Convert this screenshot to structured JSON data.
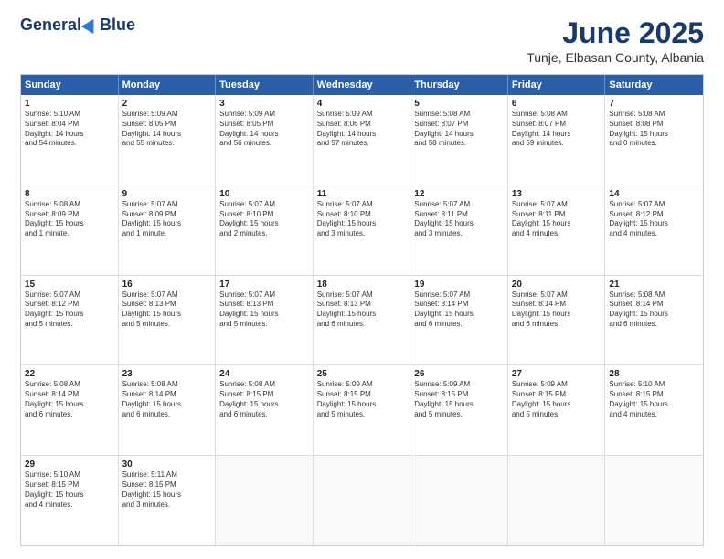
{
  "header": {
    "logo_general": "General",
    "logo_blue": "Blue",
    "month_title": "June 2025",
    "subtitle": "Tunje, Elbasan County, Albania"
  },
  "calendar": {
    "days_of_week": [
      "Sunday",
      "Monday",
      "Tuesday",
      "Wednesday",
      "Thursday",
      "Friday",
      "Saturday"
    ],
    "weeks": [
      [
        {
          "day": "",
          "text": ""
        },
        {
          "day": "2",
          "text": "Sunrise: 5:09 AM\nSunset: 8:05 PM\nDaylight: 14 hours\nand 55 minutes."
        },
        {
          "day": "3",
          "text": "Sunrise: 5:09 AM\nSunset: 8:05 PM\nDaylight: 14 hours\nand 56 minutes."
        },
        {
          "day": "4",
          "text": "Sunrise: 5:09 AM\nSunset: 8:06 PM\nDaylight: 14 hours\nand 57 minutes."
        },
        {
          "day": "5",
          "text": "Sunrise: 5:08 AM\nSunset: 8:07 PM\nDaylight: 14 hours\nand 58 minutes."
        },
        {
          "day": "6",
          "text": "Sunrise: 5:08 AM\nSunset: 8:07 PM\nDaylight: 14 hours\nand 59 minutes."
        },
        {
          "day": "7",
          "text": "Sunrise: 5:08 AM\nSunset: 8:08 PM\nDaylight: 15 hours\nand 0 minutes."
        }
      ],
      [
        {
          "day": "1",
          "text": "Sunrise: 5:10 AM\nSunset: 8:04 PM\nDaylight: 14 hours\nand 54 minutes."
        },
        {
          "day": "9",
          "text": "Sunrise: 5:07 AM\nSunset: 8:09 PM\nDaylight: 15 hours\nand 1 minute."
        },
        {
          "day": "10",
          "text": "Sunrise: 5:07 AM\nSunset: 8:10 PM\nDaylight: 15 hours\nand 2 minutes."
        },
        {
          "day": "11",
          "text": "Sunrise: 5:07 AM\nSunset: 8:10 PM\nDaylight: 15 hours\nand 3 minutes."
        },
        {
          "day": "12",
          "text": "Sunrise: 5:07 AM\nSunset: 8:11 PM\nDaylight: 15 hours\nand 3 minutes."
        },
        {
          "day": "13",
          "text": "Sunrise: 5:07 AM\nSunset: 8:11 PM\nDaylight: 15 hours\nand 4 minutes."
        },
        {
          "day": "14",
          "text": "Sunrise: 5:07 AM\nSunset: 8:12 PM\nDaylight: 15 hours\nand 4 minutes."
        }
      ],
      [
        {
          "day": "8",
          "text": "Sunrise: 5:08 AM\nSunset: 8:09 PM\nDaylight: 15 hours\nand 1 minute."
        },
        {
          "day": "16",
          "text": "Sunrise: 5:07 AM\nSunset: 8:13 PM\nDaylight: 15 hours\nand 5 minutes."
        },
        {
          "day": "17",
          "text": "Sunrise: 5:07 AM\nSunset: 8:13 PM\nDaylight: 15 hours\nand 5 minutes."
        },
        {
          "day": "18",
          "text": "Sunrise: 5:07 AM\nSunset: 8:13 PM\nDaylight: 15 hours\nand 6 minutes."
        },
        {
          "day": "19",
          "text": "Sunrise: 5:07 AM\nSunset: 8:14 PM\nDaylight: 15 hours\nand 6 minutes."
        },
        {
          "day": "20",
          "text": "Sunrise: 5:07 AM\nSunset: 8:14 PM\nDaylight: 15 hours\nand 6 minutes."
        },
        {
          "day": "21",
          "text": "Sunrise: 5:08 AM\nSunset: 8:14 PM\nDaylight: 15 hours\nand 6 minutes."
        }
      ],
      [
        {
          "day": "15",
          "text": "Sunrise: 5:07 AM\nSunset: 8:12 PM\nDaylight: 15 hours\nand 5 minutes."
        },
        {
          "day": "23",
          "text": "Sunrise: 5:08 AM\nSunset: 8:14 PM\nDaylight: 15 hours\nand 6 minutes."
        },
        {
          "day": "24",
          "text": "Sunrise: 5:08 AM\nSunset: 8:15 PM\nDaylight: 15 hours\nand 6 minutes."
        },
        {
          "day": "25",
          "text": "Sunrise: 5:09 AM\nSunset: 8:15 PM\nDaylight: 15 hours\nand 5 minutes."
        },
        {
          "day": "26",
          "text": "Sunrise: 5:09 AM\nSunset: 8:15 PM\nDaylight: 15 hours\nand 5 minutes."
        },
        {
          "day": "27",
          "text": "Sunrise: 5:09 AM\nSunset: 8:15 PM\nDaylight: 15 hours\nand 5 minutes."
        },
        {
          "day": "28",
          "text": "Sunrise: 5:10 AM\nSunset: 8:15 PM\nDaylight: 15 hours\nand 4 minutes."
        }
      ],
      [
        {
          "day": "22",
          "text": "Sunrise: 5:08 AM\nSunset: 8:14 PM\nDaylight: 15 hours\nand 6 minutes."
        },
        {
          "day": "30",
          "text": "Sunrise: 5:11 AM\nSunset: 8:15 PM\nDaylight: 15 hours\nand 3 minutes."
        },
        {
          "day": "",
          "text": ""
        },
        {
          "day": "",
          "text": ""
        },
        {
          "day": "",
          "text": ""
        },
        {
          "day": "",
          "text": ""
        },
        {
          "day": "",
          "text": ""
        }
      ],
      [
        {
          "day": "29",
          "text": "Sunrise: 5:10 AM\nSunset: 8:15 PM\nDaylight: 15 hours\nand 4 minutes."
        },
        {
          "day": "",
          "text": ""
        },
        {
          "day": "",
          "text": ""
        },
        {
          "day": "",
          "text": ""
        },
        {
          "day": "",
          "text": ""
        },
        {
          "day": "",
          "text": ""
        },
        {
          "day": "",
          "text": ""
        }
      ]
    ]
  }
}
